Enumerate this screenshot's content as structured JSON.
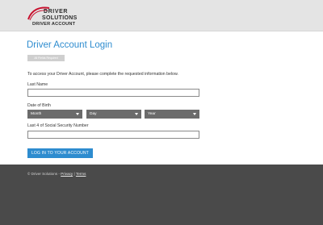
{
  "header": {
    "logo": {
      "name": "driver-solutions-logo",
      "line1": "DRIVER",
      "line2": "SOLUTIONS",
      "line3": "DRIVER ACCOUNT"
    }
  },
  "main": {
    "title": "Driver Account Login",
    "badge": "All Fields Required",
    "intro": "To access your Driver Account, please complete the requested information below.",
    "last_name_label": "Last Name",
    "last_name_value": "",
    "dob_label": "Date of Birth",
    "month": "Month",
    "day": "Day",
    "year": "Year",
    "ssn_label": "Last 4 of Social Security Number",
    "ssn_value": "",
    "login_button": "LOG IN TO YOUR ACCOUNT"
  },
  "footer": {
    "copyright": "© Driver Solutions - ",
    "privacy": "Privacy",
    "separator": " | ",
    "terms": "Terms"
  },
  "colors": {
    "accent": "#2e8ccf",
    "header_bg": "#e4e4e4",
    "footer_bg": "#4a4a4a",
    "select_bg": "#6b6b6b",
    "logo_red": "#c8102e"
  }
}
